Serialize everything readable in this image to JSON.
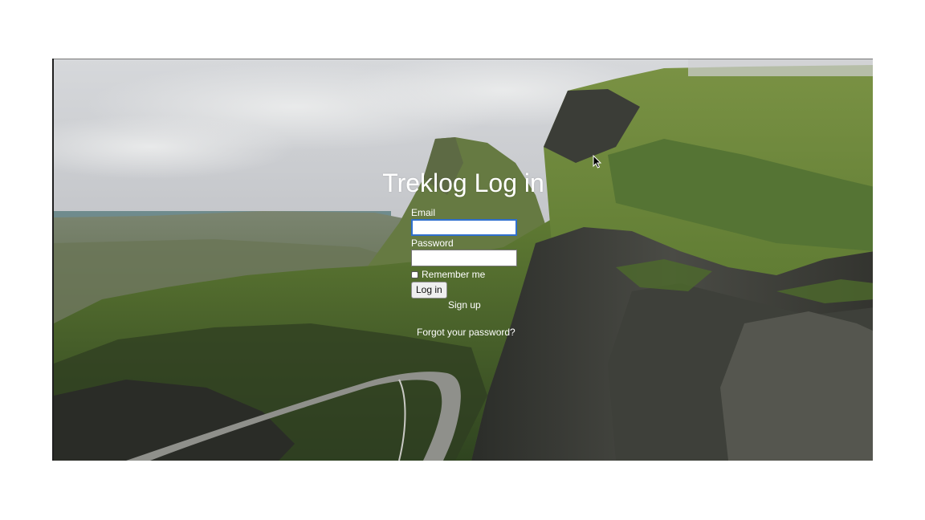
{
  "page": {
    "title": "Treklog Log in"
  },
  "form": {
    "email_label": "Email",
    "email_value": "",
    "password_label": "Password",
    "password_value": "",
    "remember_label": "Remember me",
    "remember_checked": false,
    "submit_label": "Log in"
  },
  "links": {
    "signup": "Sign up",
    "forgot": "Forgot your password?"
  },
  "background": {
    "image": "mountain-landscape-photo",
    "colors": {
      "sky": "#c9cbcf",
      "grass": "#4f6a2c",
      "rock": "#3a3a36",
      "road": "#9a9a96"
    }
  },
  "icons": {
    "cursor": "mouse-pointer-icon"
  }
}
